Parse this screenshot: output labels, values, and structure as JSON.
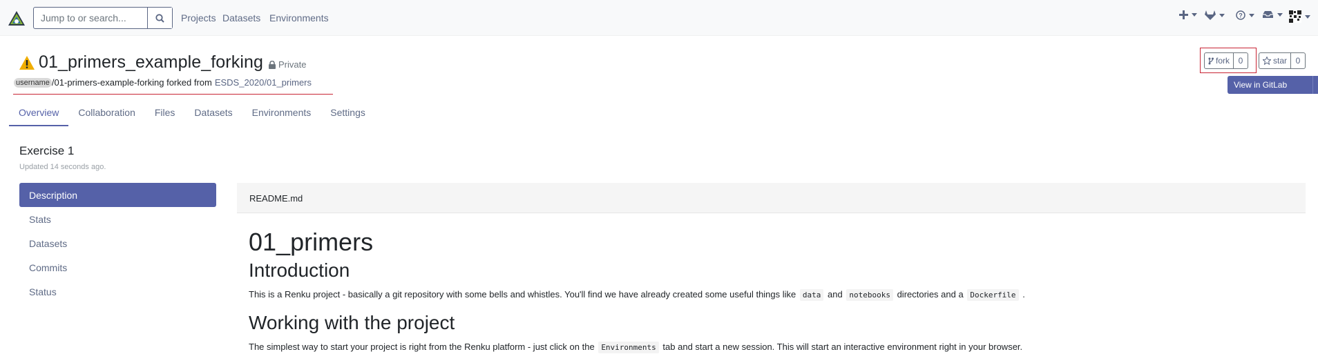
{
  "navbar": {
    "search_placeholder": "Jump to or search...",
    "links": [
      "Projects",
      "Datasets",
      "Environments"
    ],
    "icons": [
      "plus-icon",
      "gitlab-icon",
      "help-icon",
      "inbox-icon",
      "avatar-qr"
    ]
  },
  "project": {
    "title": "01_primers_example_forking",
    "visibility": "Private",
    "username_chip": "username",
    "path": "/01-primers-example-forking forked from",
    "fork_source": "ESDS_2020/01_primers",
    "fork_label": "fork",
    "fork_count": "0",
    "star_label": "star",
    "star_count": "0",
    "gitlab_label": "View in GitLab"
  },
  "tabs": [
    "Overview",
    "Collaboration",
    "Files",
    "Datasets",
    "Environments",
    "Settings"
  ],
  "active_tab": "Overview",
  "overview": {
    "title": "Exercise 1",
    "updated": "Updated 14 seconds ago.",
    "side_items": [
      "Description",
      "Stats",
      "Datasets",
      "Commits",
      "Status"
    ],
    "active_item": "Description"
  },
  "readme": {
    "filename": "README.md",
    "h1": "01_primers",
    "h2_intro": "Introduction",
    "intro_text_1": "This is a Renku project - basically a git repository with some bells and whistles. You'll find we have already created some useful things like",
    "intro_code_1": "data",
    "intro_text_2": "and",
    "intro_code_2": "notebooks",
    "intro_text_3": "directories and a",
    "intro_code_3": "Dockerfile",
    "intro_text_4": ".",
    "h2_working": "Working with the project",
    "working_text_1": "The simplest way to start your project is right from the Renku platform - just click on the",
    "working_code": "Environments",
    "working_text_2": "tab and start a new session. This will start an interactive environment right in your browser."
  },
  "colors": {
    "accent": "#5561a8",
    "highlight_red": "#c82333",
    "warning": "#f0ad00"
  }
}
